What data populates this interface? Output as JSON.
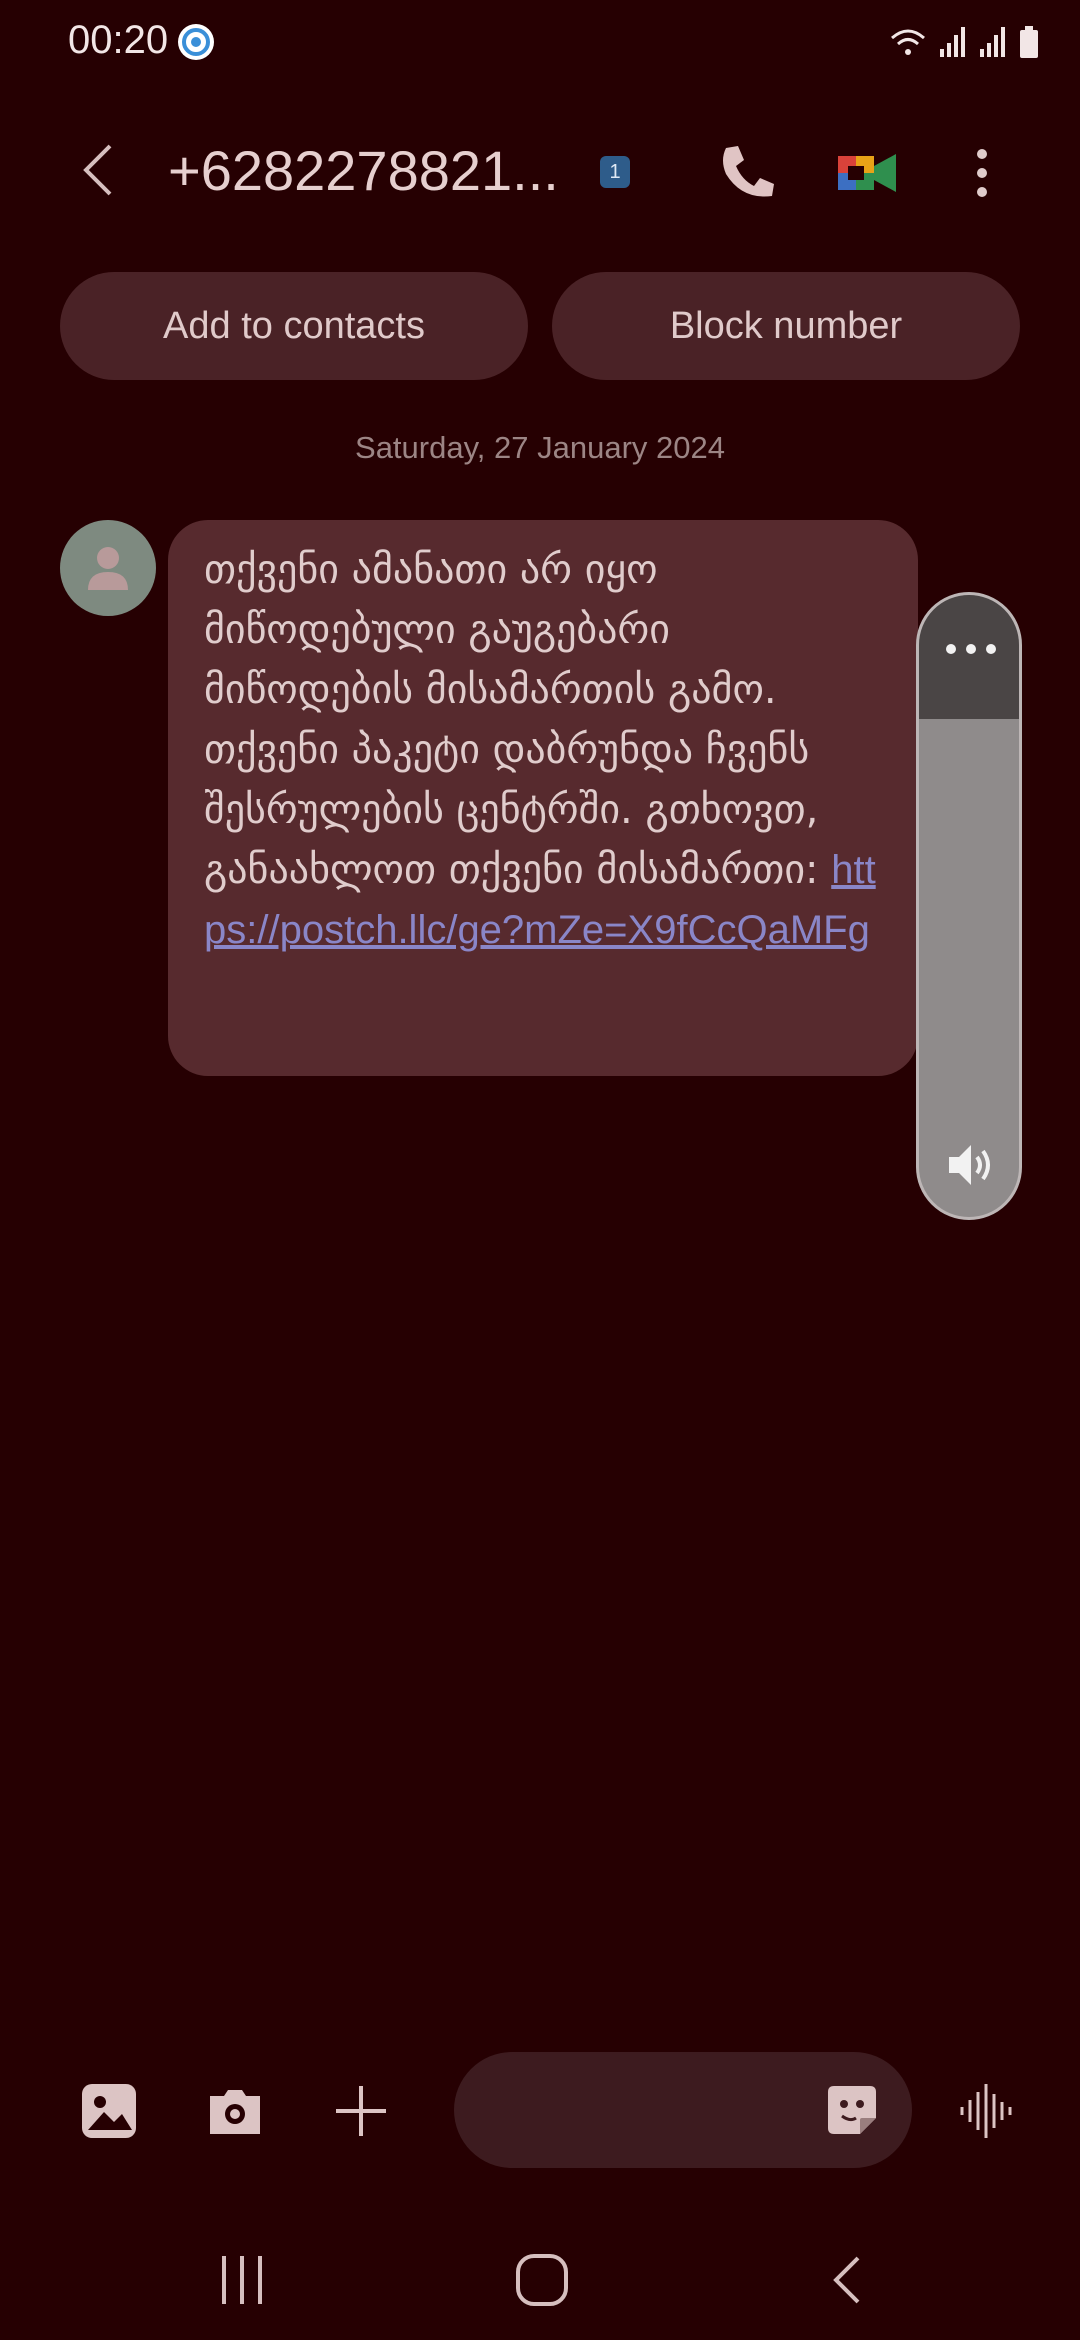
{
  "status_bar": {
    "time": "00:20",
    "icons": [
      "aperture-icon",
      "wifi-icon",
      "signal-icon",
      "signal-icon",
      "battery-icon"
    ]
  },
  "header": {
    "title": "+6282278821...",
    "sim_badge": "1",
    "icons": [
      "back-arrow-icon",
      "phone-icon",
      "video-call-icon",
      "more-vertical-icon"
    ]
  },
  "actions": {
    "add_to_contacts": "Add to contacts",
    "block_number": "Block number"
  },
  "conversation": {
    "date": "Saturday, 27 January 2024",
    "message": {
      "text": "თქვენი ამანათი არ იყო მიწოდებული გაუგებარი მიწოდების მისამართის გამო. თქვენი პაკეტი დაბრუნდა ჩვენს შესრულების ცენტრში. გთხოვთ, განაახლოთ თქვენი მისამართი: ",
      "link": "https://postch.llc/ge?mZe=X9fCcQaMFg"
    }
  },
  "volume_panel": {
    "icons": [
      "more-horizontal-icon",
      "speaker-icon"
    ]
  },
  "composer": {
    "icons": [
      "gallery-icon",
      "camera-icon",
      "plus-icon",
      "sticker-icon",
      "voice-icon"
    ]
  },
  "nav_bar": {
    "icons": [
      "recents-icon",
      "home-icon",
      "back-icon"
    ]
  },
  "colors": {
    "background": "#260002",
    "bubble": "#572a2e",
    "pill": "#4a2226",
    "link": "#8a86c8"
  }
}
